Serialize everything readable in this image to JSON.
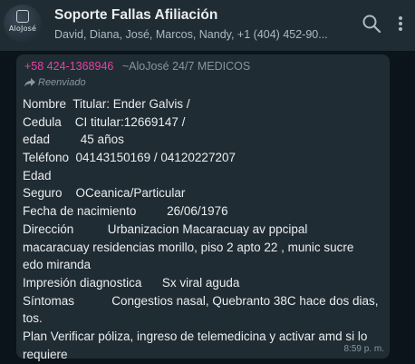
{
  "header": {
    "avatar_text": "AloJosé",
    "title": "Soporte Fallas Afiliación",
    "members": "David, Diana, José, Marcos, Nandy, +1 (404) 452-90..."
  },
  "message": {
    "sender_phone": "+58 424-1368946",
    "sender_name": "~AloJosé 24/7 MEDICOS",
    "forwarded_label": "Reenviado",
    "lines": [
      "Nombre  Titular: Ender Galvis /",
      "Cedula    CI titular:12669147 /",
      "edad         45 años",
      "Teléfono  04143150169 / 04120227207",
      "Edad",
      "Seguro    OCeanica/Particular",
      "Fecha de nacimiento         26/06/1976",
      "Dirección          Urbanizacion Macaracuay av ppcipal",
      "macaracuay residencias morillo, piso 2 apto 22 , munic sucre",
      "edo miranda",
      "Impresión diagnostica      Sx viral aguda",
      "Síntomas           Congestios nasal, Quebranto 38C hace dos dias,",
      "tos.",
      "Plan Verificar póliza, ingreso de telemedicina y activar amd si lo",
      "requiere"
    ],
    "time": "8:59 p. m."
  },
  "icons": {
    "search": "search-icon",
    "menu": "more-vertical-icon",
    "forwarded": "forward-arrow-icon"
  },
  "colors": {
    "header_bg": "#202c33",
    "chat_bg": "#0b141a",
    "bubble_bg": "#202c33",
    "sender_phone": "#e542a3",
    "muted": "#8696a0"
  }
}
